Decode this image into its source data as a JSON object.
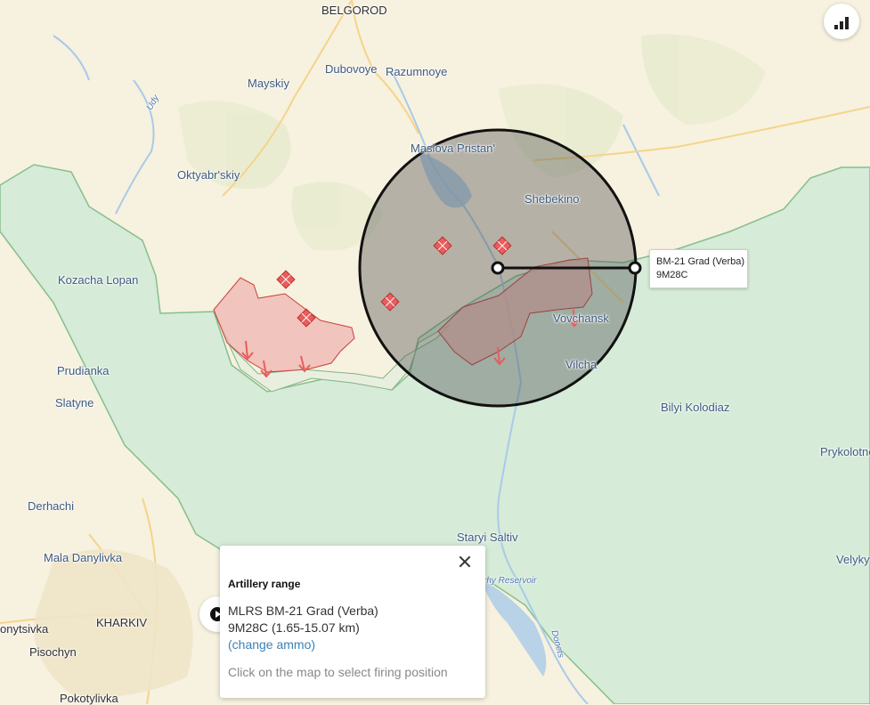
{
  "map": {
    "places": [
      {
        "id": "belgorod",
        "name": "BELGOROD",
        "style": "dark"
      },
      {
        "id": "mayskiy",
        "name": "Mayskiy"
      },
      {
        "id": "dubovoye",
        "name": "Dubovoye"
      },
      {
        "id": "razumnoye",
        "name": "Razumnoye"
      },
      {
        "id": "udy",
        "name": "Udy",
        "style": "italic"
      },
      {
        "id": "maslova",
        "name": "Maslova Pristan'"
      },
      {
        "id": "oktyabrskiy",
        "name": "Oktyabr'skiy"
      },
      {
        "id": "shebekino",
        "name": "Shebekino"
      },
      {
        "id": "kozacha",
        "name": "Kozacha Lopan"
      },
      {
        "id": "vovchansk",
        "name": "Vovchansk"
      },
      {
        "id": "vilcha",
        "name": "Vilcha"
      },
      {
        "id": "prudianka",
        "name": "Prudianka"
      },
      {
        "id": "slatyne",
        "name": "Slatyne"
      },
      {
        "id": "bilyi",
        "name": "Bilyi Kolodiaz"
      },
      {
        "id": "prykolotne",
        "name": "Prykolotne"
      },
      {
        "id": "derhachi",
        "name": "Derhachi"
      },
      {
        "id": "staryi",
        "name": "Staryi Saltiv"
      },
      {
        "id": "mala",
        "name": "Mala Danylivka"
      },
      {
        "id": "velyky",
        "name": "Velyky"
      },
      {
        "id": "reservoir",
        "name": "...hy Reservoir",
        "style": "italic"
      },
      {
        "id": "kharkiv",
        "name": "KHARKIV",
        "style": "dark"
      },
      {
        "id": "onytsivka",
        "name": "onytsivka",
        "style": "dark"
      },
      {
        "id": "pisochyn",
        "name": "Pisochyn",
        "style": "dark"
      },
      {
        "id": "pokotylivka",
        "name": "Pokotylivka",
        "style": "dark"
      },
      {
        "id": "donets",
        "name": "Donets",
        "style": "italic"
      }
    ],
    "colors": {
      "land": "#f7f1df",
      "ukraine": "#d6ebd8",
      "occupied": "#efb9b4",
      "occupied_border": "#c9403c",
      "marker": "#e85d5d",
      "range_fill": "#4a4a4a",
      "water": "#a8cbe8",
      "roads": "#f5d48a"
    }
  },
  "tooltip": {
    "system": "BM-21 Grad (Verba)",
    "ammo": "9M28C"
  },
  "panel": {
    "title": "Artillery range",
    "system": "MLRS BM-21 Grad (Verba)",
    "ammo_range": "9M28C (1.65-15.07 km)",
    "change_link": "(change ammo)",
    "hint": "Click on the map to select firing position"
  },
  "icons": {
    "stats": "stats-bars-icon",
    "play": "play-icon",
    "close": "close-icon",
    "attack": "attack-diamond-icon",
    "advance": "advance-arrow-icon"
  }
}
